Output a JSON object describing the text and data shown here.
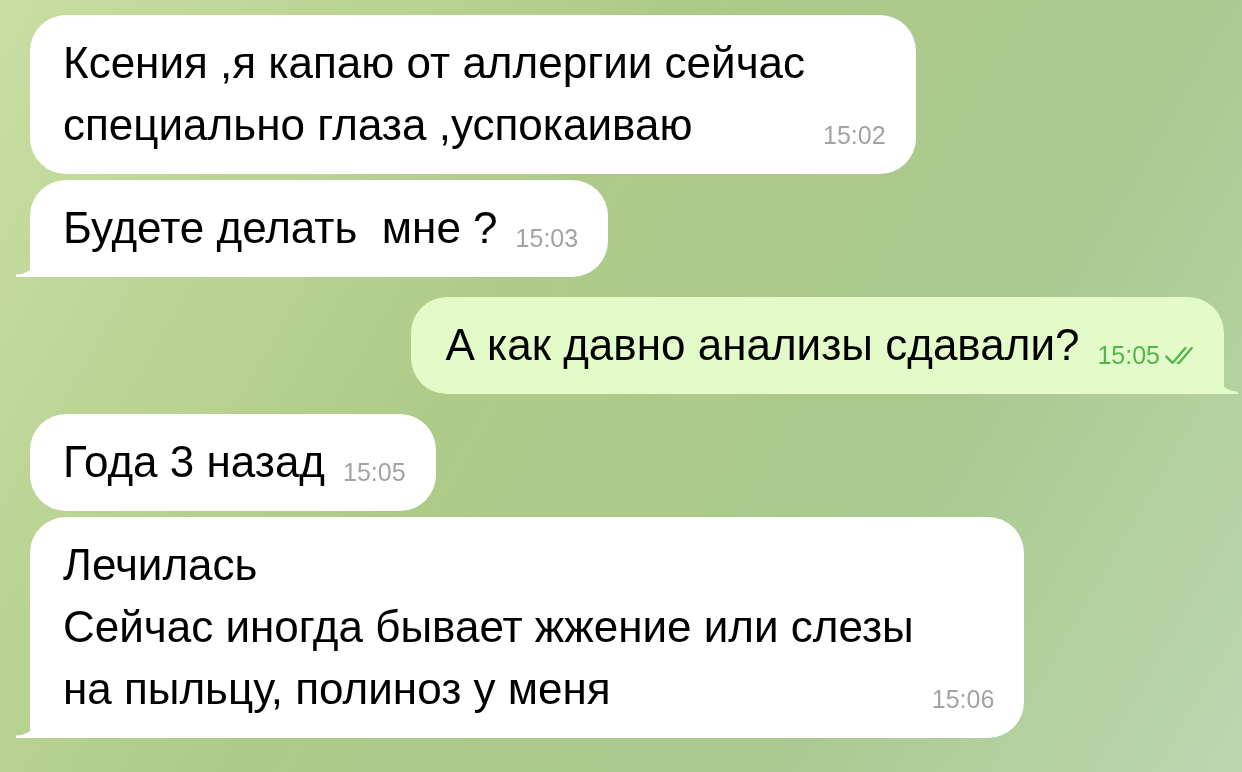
{
  "messages": [
    {
      "kind": "incoming",
      "text": "Ксения ,я капаю от аллергии сейчас\nспециально глаза ,успокаиваю",
      "time": "15:02",
      "tail": false
    },
    {
      "kind": "incoming",
      "text": "Будете делать  мне ?",
      "time": "15:03",
      "tail": true
    },
    {
      "kind": "outgoing",
      "text": "А как давно анализы сдавали?",
      "time": "15:05",
      "tail": true,
      "read": true
    },
    {
      "kind": "incoming",
      "text": "Года 3 назад",
      "time": "15:05",
      "tail": false
    },
    {
      "kind": "incoming",
      "text": "Лечилась\nСейчас иногда бывает жжение или слезы\nна пыльцу, полиноз у меня",
      "time": "15:06",
      "tail": true
    }
  ]
}
